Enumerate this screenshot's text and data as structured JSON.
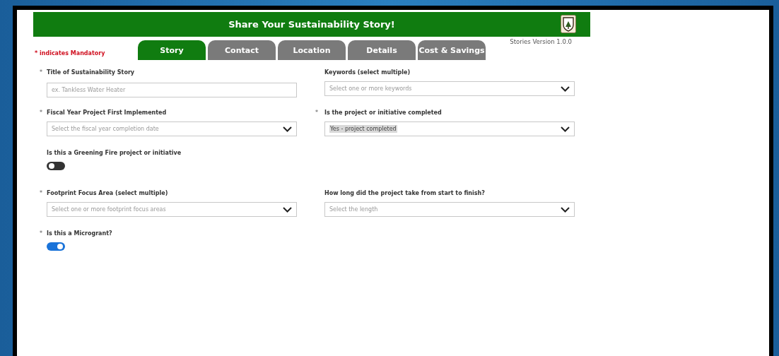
{
  "header": {
    "title": "Share Your Sustainability Story!"
  },
  "mandatory_note": "* indicates Mandatory",
  "version": "Stories Version 1.0.0",
  "tabs": [
    {
      "label": "Story",
      "selected": true
    },
    {
      "label": "Contact",
      "selected": false
    },
    {
      "label": "Location",
      "selected": false
    },
    {
      "label": "Details",
      "selected": false
    },
    {
      "label": "Cost & Savings",
      "selected": false
    }
  ],
  "fields": [
    {
      "kind": "text",
      "marker": "*",
      "label": "Title of Sustainability Story",
      "placeholder": "ex. Tankless Water Heater"
    },
    {
      "kind": "select",
      "label": "Keywords (select multiple)",
      "placeholder": "Select one or more keywords"
    },
    {
      "kind": "select",
      "marker": "*",
      "label": "Fiscal Year Project First Implemented",
      "placeholder": "Select the fiscal year completion date"
    },
    {
      "kind": "select",
      "marker": "*",
      "label": "Is the project or initiative completed",
      "value": "Yes - project completed"
    },
    {
      "kind": "toggle",
      "label": "Is this a Greening Fire project or initiative",
      "on": false
    },
    {
      "kind": "empty"
    },
    {
      "kind": "select",
      "marker": "*",
      "label": "Footprint Focus Area (select multiple)",
      "placeholder": "Select one or more footprint focus areas"
    },
    {
      "kind": "select",
      "label": "How long did the project take from start to finish?",
      "placeholder": "Select the length"
    },
    {
      "kind": "toggle",
      "marker": "*",
      "label": "Is this a Microgrant?",
      "on": true
    }
  ]
}
